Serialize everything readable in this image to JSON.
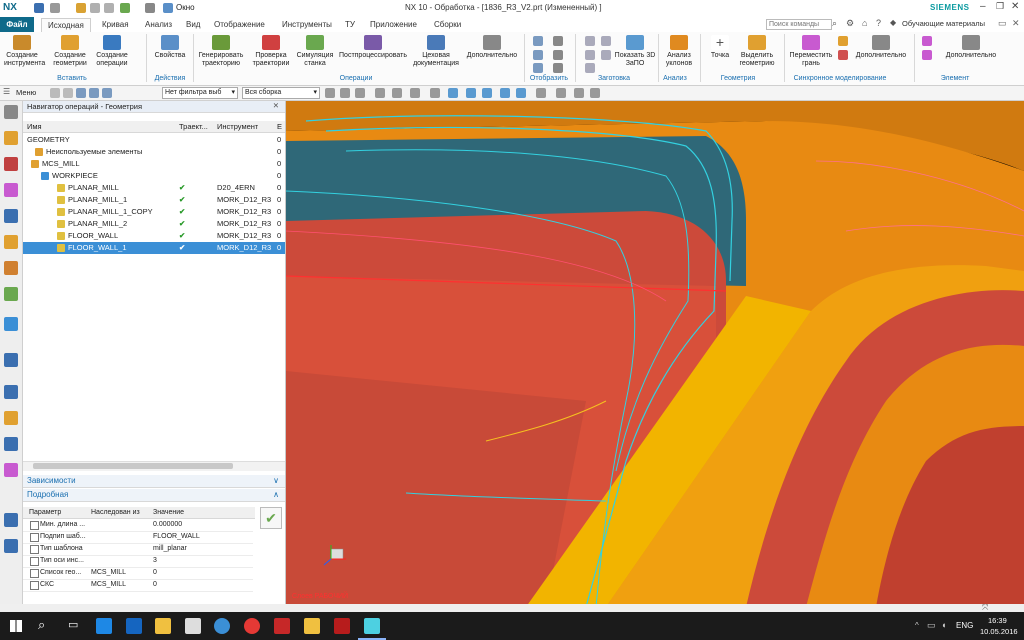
{
  "titlebar": {
    "app": "NX",
    "window_menu": "Окно",
    "title": "NX 10 - Обработка - [1836_R3_V2.prt (Измененный) ]",
    "brand": "SIEMENS"
  },
  "menu": {
    "tabs": [
      "Файл",
      "Исходная",
      "Кривая",
      "Анализ",
      "Вид",
      "Отображение",
      "Инструменты",
      "ТУ",
      "Приложение",
      "Сборки"
    ],
    "search_placeholder": "Поиск команды",
    "learning": "Обучающие материалы"
  },
  "ribbon": {
    "buttons": [
      {
        "label": "Создание инструмента",
        "color": "#c98a2b"
      },
      {
        "label": "Создание геометрии",
        "color": "#e0a030"
      },
      {
        "label": "Создание операции",
        "color": "#3a7ac0"
      },
      {
        "label": "Свойства",
        "color": "#5a8fc8"
      },
      {
        "label": "Генерировать траекторию",
        "color": "#6a9a3a"
      },
      {
        "label": "Проверка траектории",
        "color": "#d04040"
      },
      {
        "label": "Симуляция станка",
        "color": "#6aa84f"
      },
      {
        "label": "Постпроцессировать",
        "color": "#7a5aa8"
      },
      {
        "label": "Цеховая документация",
        "color": "#4a7ab8"
      },
      {
        "label": "Дополнительно",
        "color": "#888888"
      },
      {
        "label": "Показать 3D ЗаПО",
        "color": "#5a9ad0"
      },
      {
        "label": "Анализ уклонов",
        "color": "#e08a20"
      },
      {
        "label": "Точка",
        "color": "#777777"
      },
      {
        "label": "Выделить геометрию",
        "color": "#e0a030"
      },
      {
        "label": "Переместить грань",
        "color": "#c85ad0"
      },
      {
        "label": "Дополнительно",
        "color": "#888888"
      },
      {
        "label": "Дополнительно",
        "color": "#888888"
      }
    ],
    "groups": [
      "Вставить",
      "Действия",
      "Операции",
      "Отобразить",
      "Заготовка",
      "Анализ",
      "Геометрия",
      "Синхронное моделирование",
      "Элемент"
    ]
  },
  "toolbar2": {
    "menu_label": "Меню",
    "filter": "Нет фильтра выб",
    "assembly": "Вся сборка"
  },
  "navigator": {
    "title": "Навигатор операций - Геометрия",
    "columns": [
      "Имя",
      "Траект...",
      "Инструмент",
      "Е"
    ],
    "rows": [
      {
        "name": "GEOMETRY",
        "check": "",
        "tool": "",
        "e": "0"
      },
      {
        "name": "Неиспользуемые элементы",
        "check": "",
        "tool": "",
        "e": "0"
      },
      {
        "name": "MCS_MILL",
        "check": "",
        "tool": "",
        "e": "0"
      },
      {
        "name": "WORKPIECE",
        "check": "",
        "tool": "",
        "e": "0"
      },
      {
        "name": "PLANAR_MILL",
        "check": "✔",
        "tool": "D20_4ERN",
        "e": "0"
      },
      {
        "name": "PLANAR_MILL_1",
        "check": "✔",
        "tool": "MORK_D12_R3",
        "e": "0"
      },
      {
        "name": "PLANAR_MILL_1_COPY",
        "check": "✔",
        "tool": "MORK_D12_R3",
        "e": "0"
      },
      {
        "name": "PLANAR_MILL_2",
        "check": "✔",
        "tool": "MORK_D12_R3",
        "e": "0"
      },
      {
        "name": "FLOOR_WALL",
        "check": "✔",
        "tool": "MORK_D12_R3",
        "e": "0"
      },
      {
        "name": "FLOOR_WALL_1",
        "check": "✔",
        "tool": "MORK_D12_R3",
        "e": "0"
      }
    ],
    "dependencies": "Зависимости",
    "details": "Подробная"
  },
  "details": {
    "columns": [
      "Параметр",
      "Наследован из",
      "Значение"
    ],
    "rows": [
      {
        "param": "Мин. длина ...",
        "inherited": "",
        "value": "0.000000"
      },
      {
        "param": "Подпип шаб...",
        "inherited": "",
        "value": "FLOOR_WALL"
      },
      {
        "param": "Тип шаблона",
        "inherited": "",
        "value": "mill_planar"
      },
      {
        "param": "Тип оси инс...",
        "inherited": "",
        "value": "3"
      },
      {
        "param": "Список гео...",
        "inherited": "MCS_MILL",
        "value": "0"
      },
      {
        "param": "СКС",
        "inherited": "MCS_MILL",
        "value": "0"
      }
    ]
  },
  "viewport": {
    "layer_label": "Слоев РАБОЧИЙ"
  },
  "taskbar": {
    "lang": "ENG",
    "time": "16:39",
    "date": "10.05.2016"
  }
}
